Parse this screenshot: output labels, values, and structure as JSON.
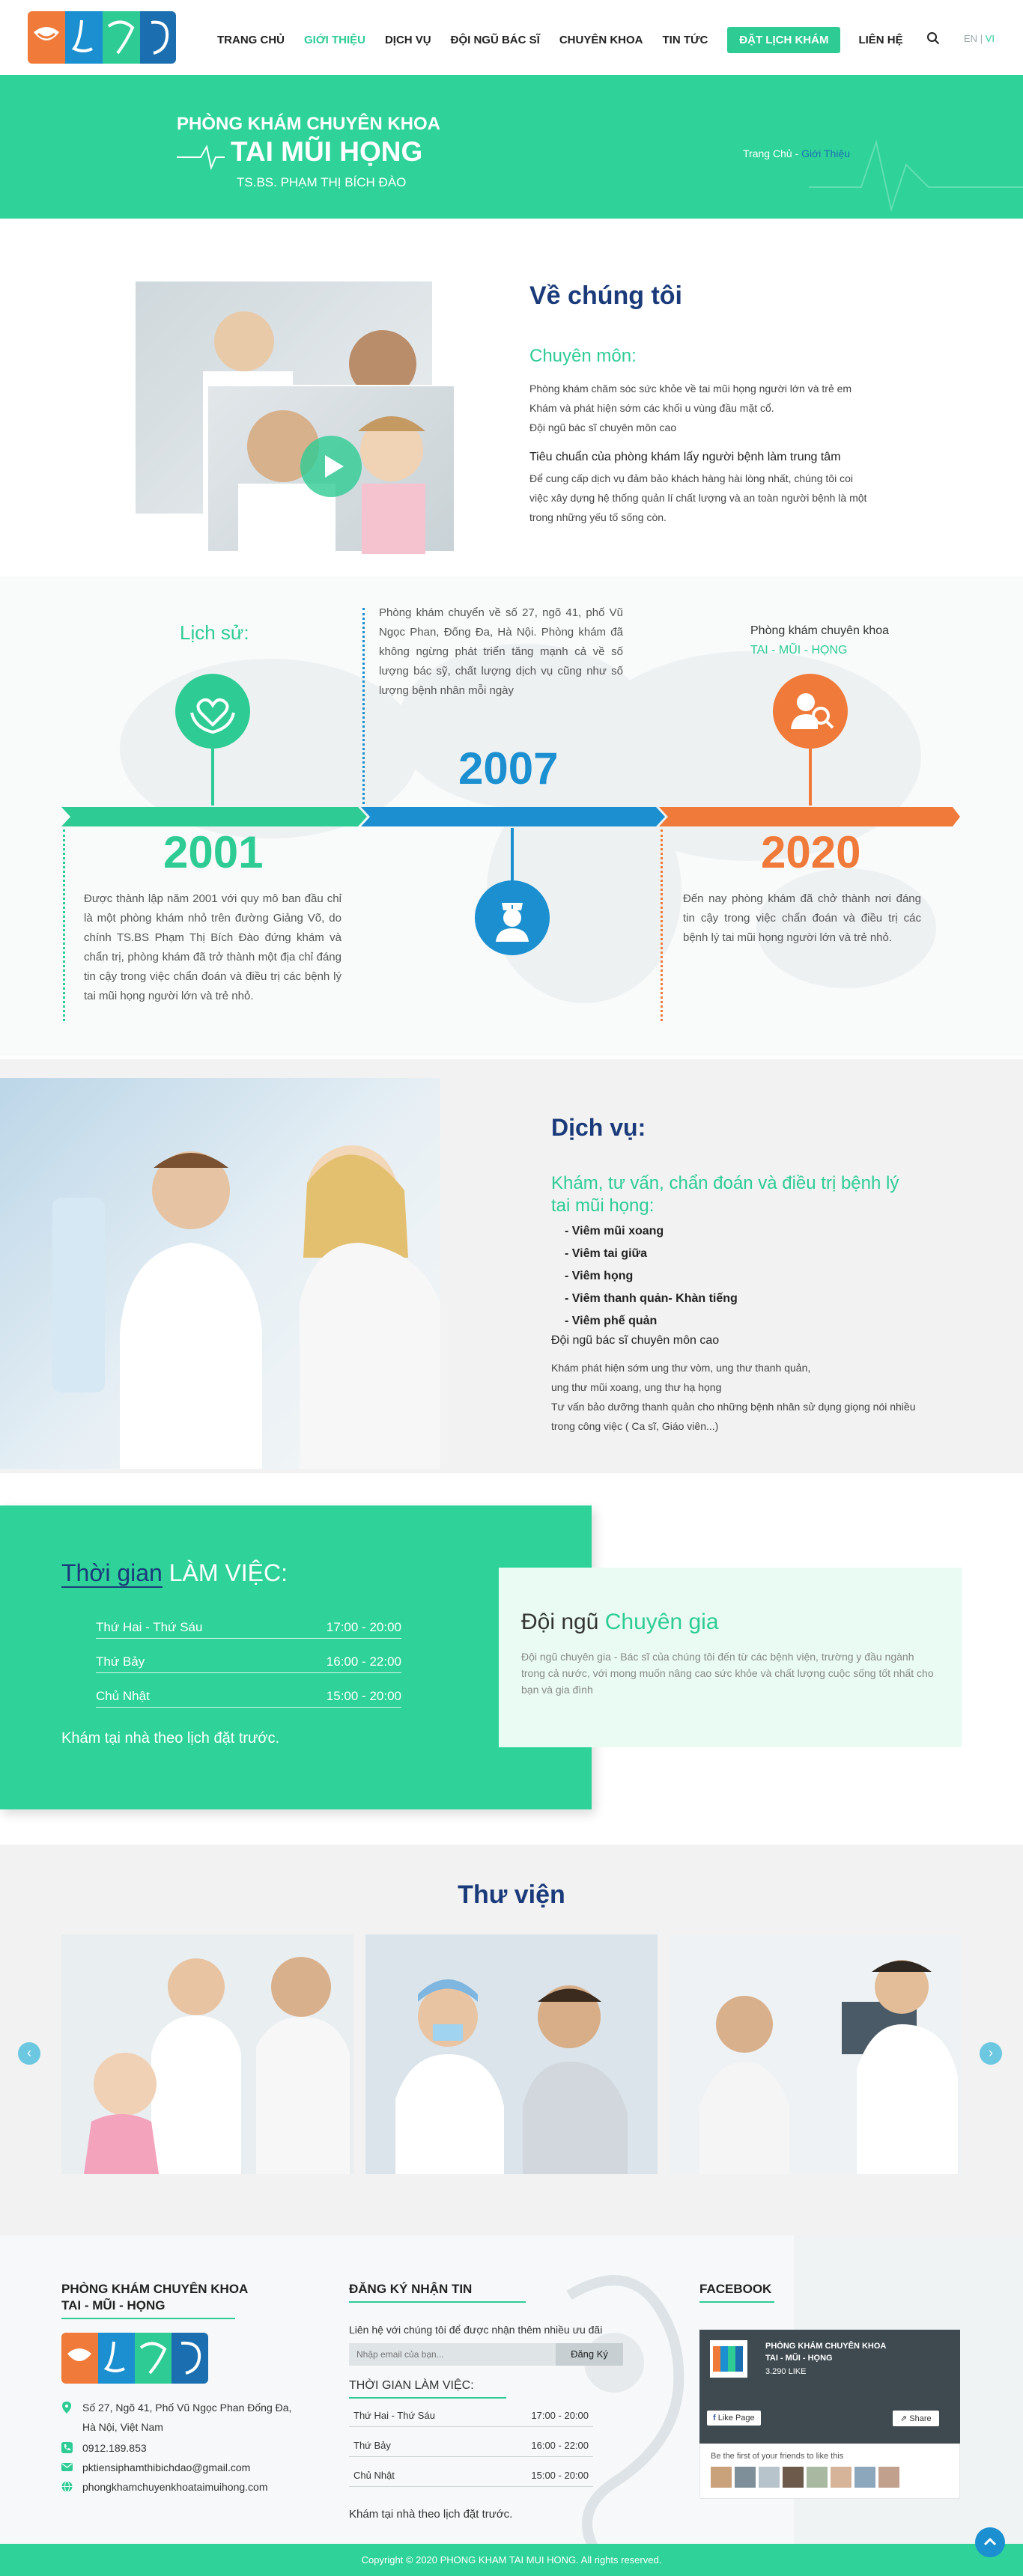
{
  "header": {
    "nav": [
      "TRANG CHỦ",
      "GIỚI THIỆU",
      "DỊCH VỤ",
      "ĐỘI NGŨ BÁC SĨ",
      "CHUYÊN KHOA",
      "TIN TỨC"
    ],
    "cta": "ĐẶT LỊCH KHÁM",
    "contact": "LIÊN HỆ",
    "lang_en": "EN",
    "lang_sep": "|",
    "lang_vi": "VI",
    "active_color": "#2ecc94"
  },
  "banner": {
    "line1": "PHÒNG KHÁM CHUYÊN KHOA",
    "line2": "TAI MŨI HỌNG",
    "line3": "TS.BS. PHẠM THỊ BÍCH ĐÀO",
    "crumb_home": "Trang Chủ",
    "crumb_sep": " - ",
    "crumb_current": "Giới Thiệu",
    "bg_color": "#2fd39a"
  },
  "about": {
    "title": "Về chúng tôi",
    "subtitle": "Chuyên môn:",
    "lines": [
      "Phòng khám chăm sóc sức khỏe về tai mũi họng người lớn và trẻ em",
      "Khám và phát hiện sớm các khối u vùng đầu mặt cổ.",
      "Đội ngũ bác sĩ chuyên môn cao"
    ],
    "criteria_title": "Tiêu chuẩn của phòng khám lấy người bệnh làm trung tâm",
    "criteria_lines": [
      "Để cung cấp dịch vụ đảm bảo khách hàng hài lòng nhất, chúng tôi coi",
      "việc xây dựng hệ thống quản lí chất lượng và an toàn người bệnh là một",
      "trong những yếu tố sống còn."
    ]
  },
  "timeline": {
    "history_label": "Lịch sử:",
    "y2001": "2001",
    "y2007": "2007",
    "y2020": "2020",
    "t2001": "Được thành lập năm 2001 với quy mô ban đầu chỉ là một phòng khám nhỏ trên đường Giảng Võ, do chính TS.BS Phạm Thị Bích Đào đứng khám và chẩn trị, phòng khám đã trở thành một địa chỉ đáng tin cậy trong việc chẩn đoán và điều trị các bệnh lý tai mũi họng người lớn và trẻ nhỏ.",
    "t2007": "Phòng khám chuyển về số 27, ngõ 41, phố Vũ Ngọc Phan, Đống Đa, Hà Nội. Phòng khám đã không ngừng phát triển tăng mạnh cả về số lượng bác sỹ, chất lượng dịch vụ cũng như số lượng bệnh nhân mỗi ngày",
    "t2020": "Đến nay phòng khám đã chở thành nơi đáng tin cậy trong việc chẩn đoán và điều trị các bệnh lý tai mũi họng người lớn và trẻ nhỏ.",
    "right_title": "Phòng khám chuyên khoa",
    "right_sub": "TAI - MŨI - HỌNG",
    "colors": {
      "green": "#2ecc94",
      "blue": "#1b8fd0",
      "orange": "#f07a3a"
    }
  },
  "services": {
    "title": "Dịch vụ:",
    "sub": "Khám, tư vấn, chẩn đoán và điều trị bệnh lý tai mũi họng:",
    "items": [
      "- Viêm mũi xoang",
      "- Viêm tai giữa",
      "- Viêm họng",
      "- Viêm thanh quản- Khàn tiếng",
      "- Viêm phế quản"
    ],
    "team_line": "Đội ngũ bác sĩ chuyên môn cao",
    "lines": [
      "Khám phát hiện sớm ung thư vòm, ung thư thanh quản,",
      "ung thư mũi xoang, ung thư hạ họng",
      "Tư vấn bảo dưỡng thanh quản cho những bệnh nhân sử dụng giọng nói nhiều",
      "trong công việc ( Ca sĩ, Giáo viên...)"
    ]
  },
  "work": {
    "title_a": "Thời gian",
    "title_b": " LÀM VIỆC:",
    "rows": [
      [
        "Thứ Hai - Thứ Sáu",
        "17:00 - 20:00"
      ],
      [
        "Thứ Bảy",
        "16:00 - 22:00"
      ],
      [
        "Chủ Nhật",
        "15:00 - 20:00"
      ]
    ],
    "note": "Khám tại nhà theo lịch đặt trước."
  },
  "team": {
    "title_a": "Đội ngũ ",
    "title_b": "Chuyên gia",
    "desc": "Đội ngũ chuyên gia - Bác sĩ của chúng tôi đến từ các bệnh viện, trường y đầu ngành trong cả nước, với mong muốn nâng cao sức khỏe và chất lượng cuộc sống tốt nhất cho bạn và gia đình"
  },
  "library": {
    "title": "Thư viện",
    "prev": "‹",
    "next": "›"
  },
  "footer": {
    "brand1": "PHÒNG KHÁM CHUYÊN KHOA",
    "brand2": "TAI - MŨI - HỌNG",
    "address1": "Số 27, Ngõ 41, Phố Vũ Ngọc Phan Đống Đa,",
    "address2": "Hà Nội, Việt Nam",
    "phone": "0912.189.853",
    "email": "pktiensiphamthibichdao@gmail.com",
    "web": "phongkhamchuyenkhoataimuihong.com",
    "signup_title": "ĐĂNG KÝ NHẬN TIN",
    "signup_desc": "Liên hệ với chúng tôi để được nhận thêm nhiều ưu đãi",
    "email_placeholder": "Nhập email của bạn...",
    "signup_btn": "Đăng Ký",
    "hours_title": "THỜI GIAN LÀM VIỆC:",
    "rows": [
      [
        "Thứ Hai - Thứ Sáu",
        "17:00 - 20:00"
      ],
      [
        "Thứ Bảy",
        "16:00 - 22:00"
      ],
      [
        "Chủ Nhật",
        "15:00 - 20:00"
      ]
    ],
    "note": "Khám tại nhà theo lịch đặt trước.",
    "fb_title": "FACEBOOK",
    "fb_name1": "PHÒNG KHÁM CHUYÊN KHOA",
    "fb_name2": "TAI - MŨI - HỌNG",
    "fb_likes": "3.290 LIKE",
    "fb_like_btn": "Like Page",
    "fb_share_btn": "Share",
    "fb_friends": "Be the first of your friends to like this",
    "copyright": "Copyright © 2020 PHONG KHAM TAI MUI HONG. All rights reserved."
  }
}
